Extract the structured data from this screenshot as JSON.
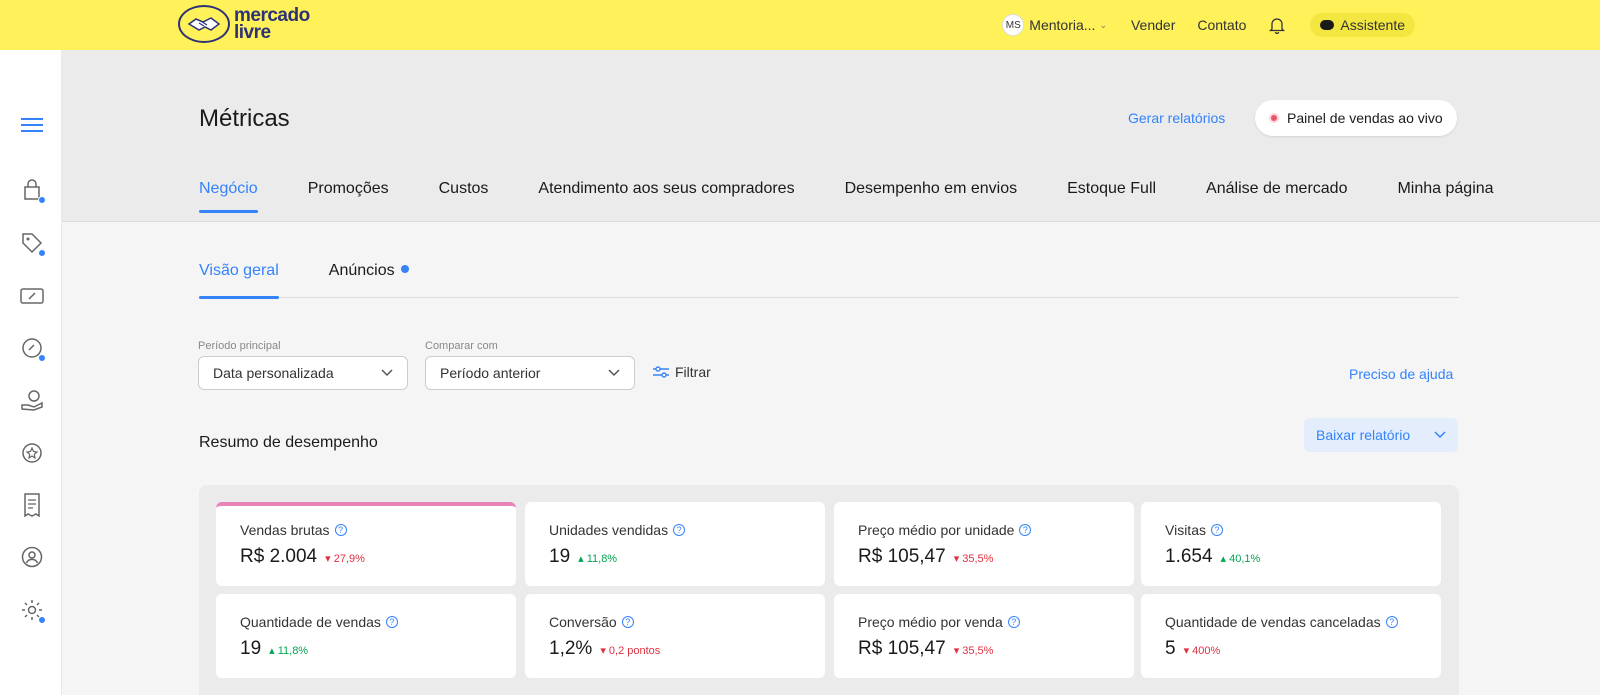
{
  "topbar": {
    "logo_text_line1": "mercado",
    "logo_text_line2": "livre",
    "user_initials": "MS",
    "user_name": "Mentoria...",
    "nav_links": [
      "Vender",
      "Contato"
    ],
    "assistant_label": "Assistente"
  },
  "sidebar": {
    "icons": [
      "menu-icon",
      "bag-icon",
      "tag-icon",
      "ticket-icon",
      "paperclip-icon",
      "money-hand-icon",
      "star-badge-icon",
      "receipt-icon",
      "user-circle-icon",
      "gear-icon"
    ]
  },
  "header": {
    "title": "Métricas",
    "gen_report": "Gerar relatórios",
    "live_panel": "Painel de vendas ao vivo",
    "tabs": [
      {
        "label": "Negócio",
        "active": true
      },
      {
        "label": "Promoções"
      },
      {
        "label": "Custos"
      },
      {
        "label": "Atendimento aos seus compradores"
      },
      {
        "label": "Desempenho em envios"
      },
      {
        "label": "Estoque Full"
      },
      {
        "label": "Análise de mercado"
      },
      {
        "label": "Minha página"
      }
    ]
  },
  "subtabs": [
    {
      "label": "Visão geral",
      "active": true
    },
    {
      "label": "Anúncios",
      "has_dot": true
    }
  ],
  "filters": {
    "period_label": "Período principal",
    "period_value": "Data personalizada",
    "compare_label": "Comparar com",
    "compare_value": "Período anterior",
    "filter_button": "Filtrar",
    "help_link": "Preciso de ajuda"
  },
  "summary": {
    "title": "Resumo de desempenho",
    "download": "Baixar relatório",
    "cards": [
      {
        "label": "Vendas brutas",
        "value": "R$ 2.004",
        "delta": "27,9%",
        "direction": "down"
      },
      {
        "label": "Unidades vendidas",
        "value": "19",
        "delta": "11,8%",
        "direction": "up"
      },
      {
        "label": "Preço médio por unidade",
        "value": "R$ 105,47",
        "delta": "35,5%",
        "direction": "down"
      },
      {
        "label": "Visitas",
        "value": "1.654",
        "delta": "40,1%",
        "direction": "up"
      },
      {
        "label": "Quantidade de vendas",
        "value": "19",
        "delta": "11,8%",
        "direction": "up"
      },
      {
        "label": "Conversão",
        "value": "1,2%",
        "delta": "0,2 pontos",
        "direction": "down"
      },
      {
        "label": "Preço médio por venda",
        "value": "R$ 105,47",
        "delta": "35,5%",
        "direction": "down"
      },
      {
        "label": "Quantidade de vendas canceladas",
        "value": "5",
        "delta": "400%",
        "direction": "down"
      }
    ]
  },
  "colors": {
    "brand_yellow": "#fff159",
    "accent_blue": "#3483fa",
    "down_red": "#e0303f",
    "up_green": "#00a650",
    "highlight_pink": "#e882b8"
  }
}
